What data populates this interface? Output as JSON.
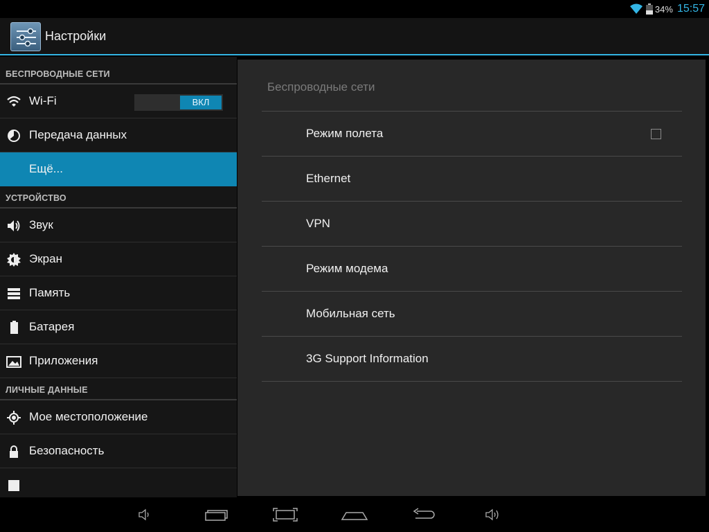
{
  "statusbar": {
    "battery_percent": "34%",
    "time": "15:57",
    "wifi_icon": "wifi-icon",
    "battery_icon": "battery-icon"
  },
  "actionbar": {
    "title": "Настройки",
    "app_icon": "settings-app-icon"
  },
  "sidebar": {
    "sections": [
      {
        "header": "БЕСПРОВОДНЫЕ СЕТИ",
        "items": [
          {
            "label": "Wi-Fi",
            "icon": "wifi-icon",
            "toggle": "ВКЛ"
          },
          {
            "label": "Передача данных",
            "icon": "data-usage-icon"
          },
          {
            "label": "Ещё...",
            "icon": "",
            "selected": true
          }
        ]
      },
      {
        "header": "УСТРОЙСТВО",
        "items": [
          {
            "label": "Звук",
            "icon": "sound-icon"
          },
          {
            "label": "Экран",
            "icon": "display-icon"
          },
          {
            "label": "Память",
            "icon": "storage-icon"
          },
          {
            "label": "Батарея",
            "icon": "battery-icon"
          },
          {
            "label": "Приложения",
            "icon": "apps-icon"
          }
        ]
      },
      {
        "header": "ЛИЧНЫЕ ДАННЫЕ",
        "items": [
          {
            "label": "Мое местоположение",
            "icon": "location-icon"
          },
          {
            "label": "Безопасность",
            "icon": "lock-icon"
          }
        ]
      }
    ]
  },
  "main": {
    "title": "Беспроводные сети",
    "items": [
      {
        "label": "Режим полета",
        "checkbox": false
      },
      {
        "label": "Ethernet"
      },
      {
        "label": "VPN"
      },
      {
        "label": "Режим модема"
      },
      {
        "label": "Мобильная сеть"
      },
      {
        "label": "3G Support Information"
      }
    ]
  },
  "navbar": {
    "buttons": [
      "volume-down-icon",
      "recent-apps-icon",
      "screenshot-icon",
      "home-icon",
      "back-icon",
      "volume-up-icon"
    ]
  },
  "colors": {
    "accent": "#33b5e5",
    "selected": "#0f86b3"
  }
}
